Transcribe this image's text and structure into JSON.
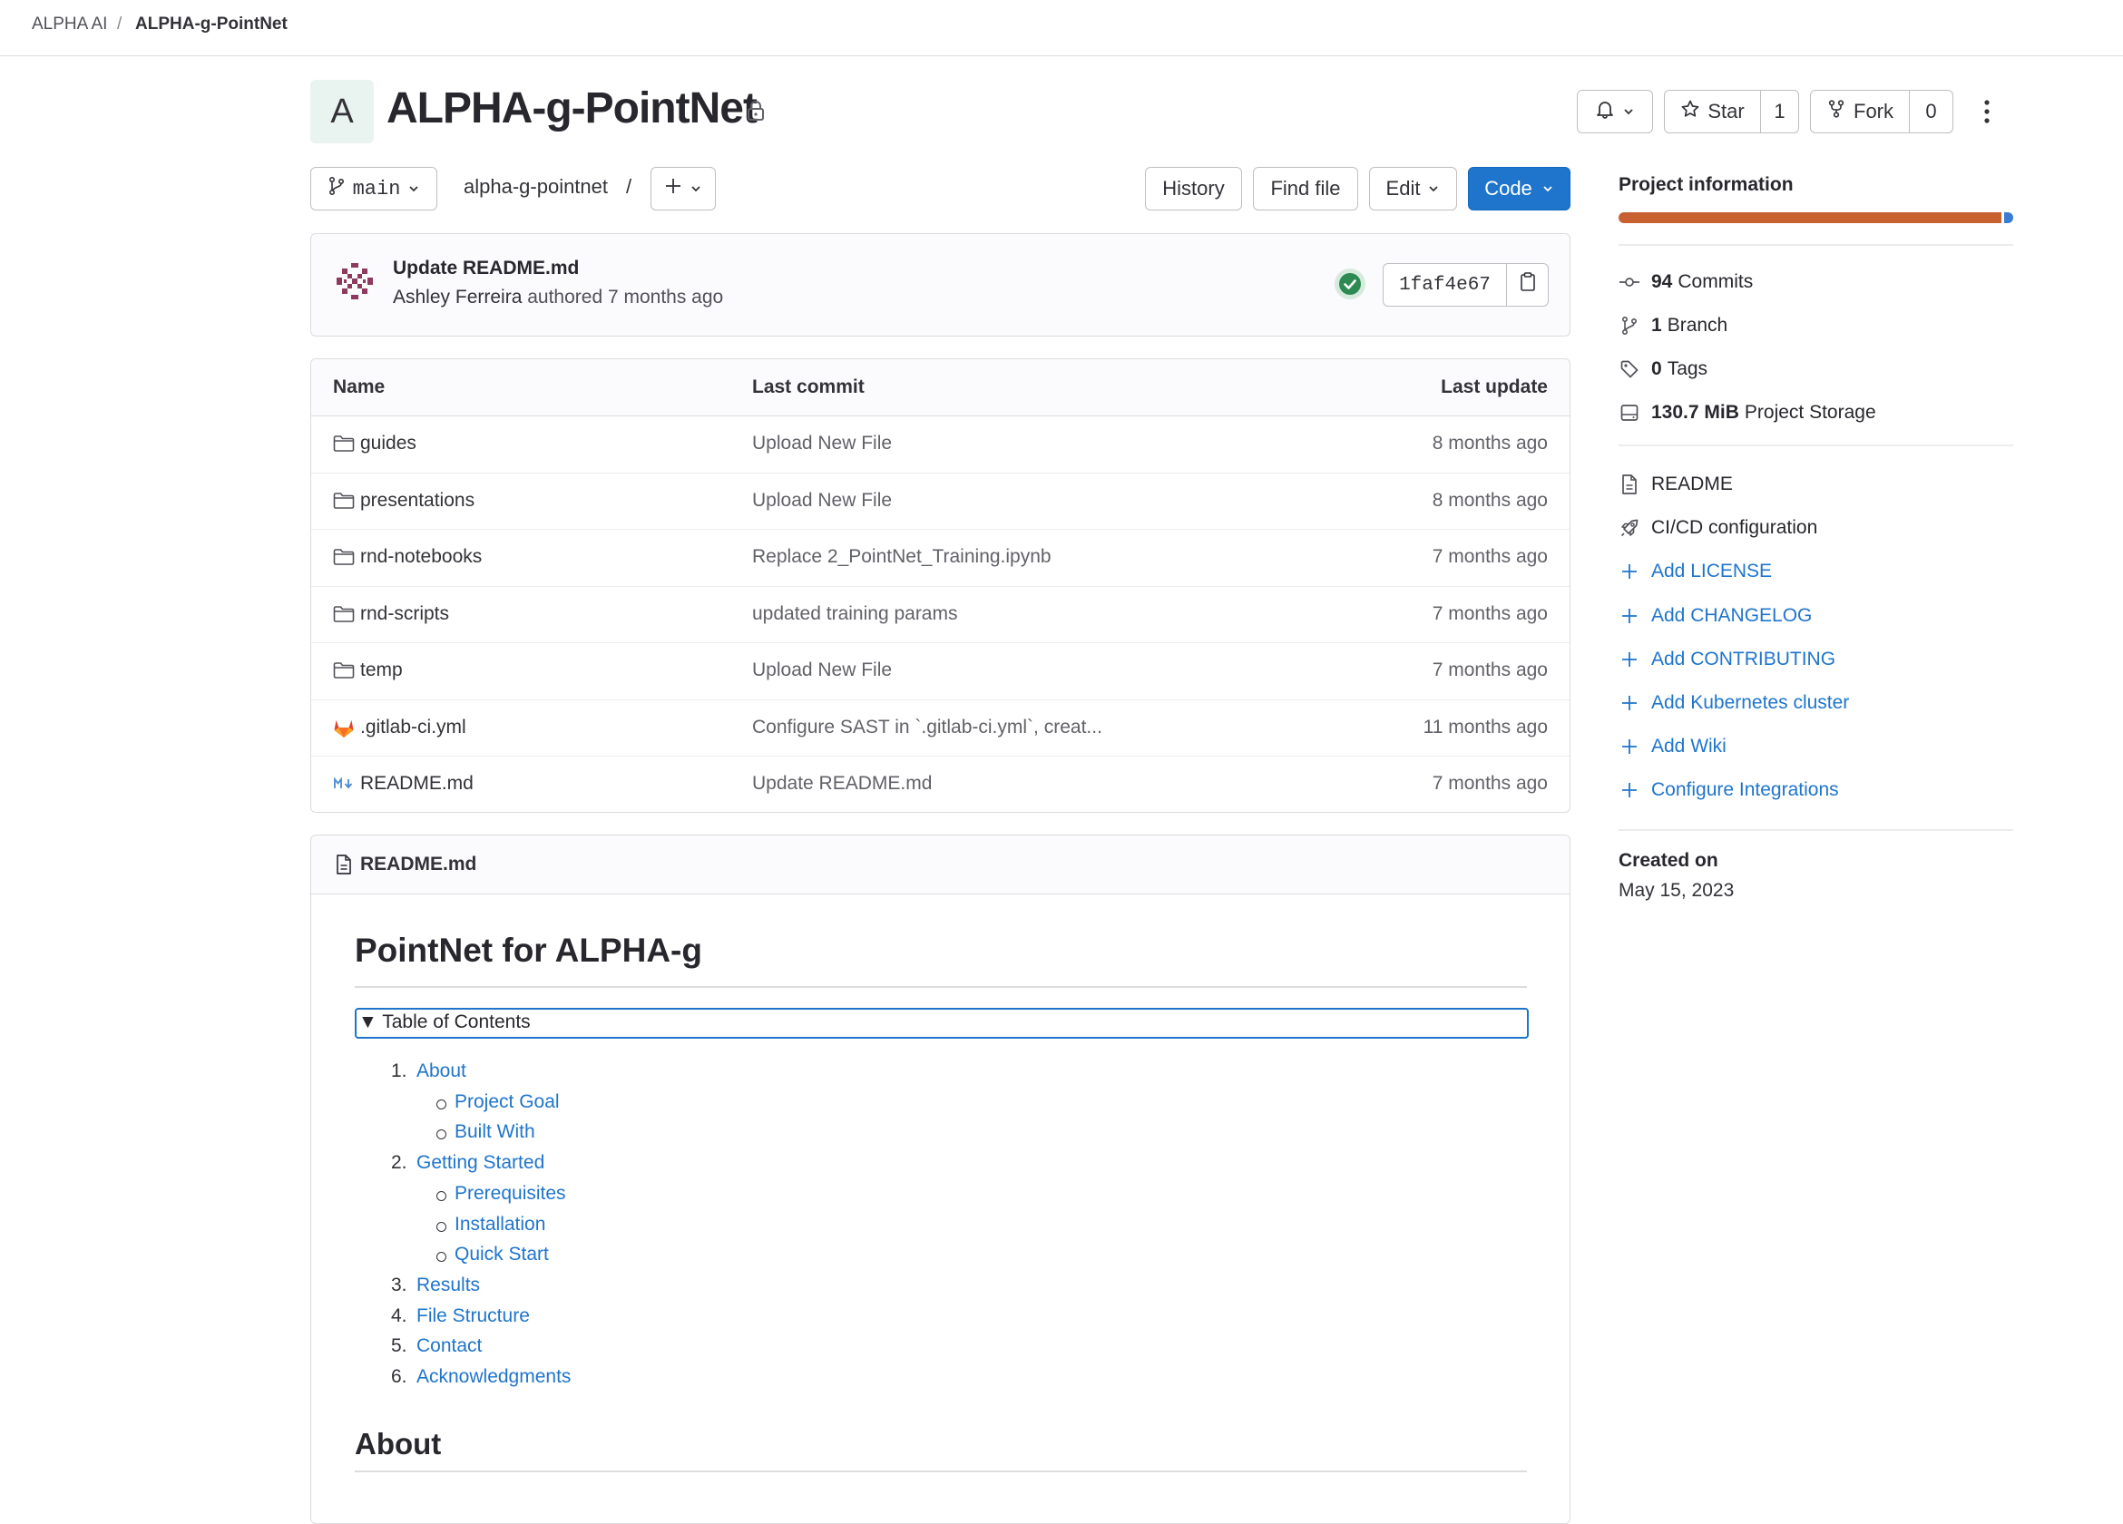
{
  "breadcrumb": {
    "group": "ALPHA AI",
    "separator": "/",
    "project": "ALPHA-g-PointNet"
  },
  "project": {
    "avatar_letter": "A",
    "title": "ALPHA-g-PointNet",
    "visibility_icon": "lock-icon"
  },
  "header_actions": {
    "notification_icon": "bell-icon",
    "star_label": "Star",
    "star_count": "1",
    "fork_label": "Fork",
    "fork_count": "0",
    "more_icon": "kebab-icon"
  },
  "toolbar": {
    "branch": "main",
    "path": "alpha-g-pointnet",
    "path_separator": "/",
    "history": "History",
    "find_file": "Find file",
    "edit": "Edit",
    "code": "Code"
  },
  "last_commit": {
    "title": "Update README.md",
    "author": "Ashley Ferreira",
    "meta": "authored 7 months ago",
    "status": "success",
    "sha": "1faf4e67"
  },
  "file_table": {
    "headers": {
      "name": "Name",
      "commit": "Last commit",
      "update": "Last update"
    },
    "rows": [
      {
        "icon": "folder-icon",
        "name": "guides",
        "commit": "Upload New File",
        "update": "8 months ago"
      },
      {
        "icon": "folder-icon",
        "name": "presentations",
        "commit": "Upload New File",
        "update": "8 months ago"
      },
      {
        "icon": "folder-icon",
        "name": "rnd-notebooks",
        "commit": "Replace 2_PointNet_Training.ipynb",
        "update": "7 months ago"
      },
      {
        "icon": "folder-icon",
        "name": "rnd-scripts",
        "commit": "updated training params",
        "update": "7 months ago"
      },
      {
        "icon": "folder-icon",
        "name": "temp",
        "commit": "Upload New File",
        "update": "7 months ago"
      },
      {
        "icon": "gitlab-icon",
        "name": ".gitlab-ci.yml",
        "commit": "Configure SAST in `.gitlab-ci.yml`, creat...",
        "update": "11 months ago"
      },
      {
        "icon": "markdown-icon",
        "name": "README.md",
        "commit": "Update README.md",
        "update": "7 months ago"
      }
    ]
  },
  "readme": {
    "filename": "README.md",
    "heading": "PointNet for ALPHA-g",
    "toc_summary": "▼ Table of Contents",
    "toc": [
      {
        "num": "1.",
        "label": "About",
        "children": [
          "Project Goal",
          "Built With"
        ]
      },
      {
        "num": "2.",
        "label": "Getting Started",
        "children": [
          "Prerequisites",
          "Installation",
          "Quick Start"
        ]
      },
      {
        "num": "3.",
        "label": "Results",
        "children": []
      },
      {
        "num": "4.",
        "label": "File Structure",
        "children": []
      },
      {
        "num": "5.",
        "label": "Contact",
        "children": []
      },
      {
        "num": "6.",
        "label": "Acknowledgments",
        "children": []
      }
    ],
    "section_heading": "About"
  },
  "sidebar": {
    "title": "Project information",
    "language_bar_colors": [
      "#c9602f",
      "#3a7bd5"
    ],
    "stats": [
      {
        "icon": "commit-icon",
        "value": "94",
        "label": "Commits"
      },
      {
        "icon": "branch-icon",
        "value": "1",
        "label": "Branch"
      },
      {
        "icon": "tag-icon",
        "value": "0",
        "label": "Tags"
      },
      {
        "icon": "storage-icon",
        "value": "130.7 MiB",
        "label": "Project Storage"
      }
    ],
    "links": [
      {
        "icon": "document-icon",
        "label": "README",
        "style": "plain"
      },
      {
        "icon": "rocket-icon",
        "label": "CI/CD configuration",
        "style": "plain"
      },
      {
        "icon": "plus-icon",
        "label": "Add LICENSE",
        "style": "link"
      },
      {
        "icon": "plus-icon",
        "label": "Add CHANGELOG",
        "style": "link"
      },
      {
        "icon": "plus-icon",
        "label": "Add CONTRIBUTING",
        "style": "link"
      },
      {
        "icon": "plus-icon",
        "label": "Add Kubernetes cluster",
        "style": "link"
      },
      {
        "icon": "plus-icon",
        "label": "Add Wiki",
        "style": "link"
      },
      {
        "icon": "plus-icon",
        "label": "Configure Integrations",
        "style": "link"
      }
    ],
    "created_label": "Created on",
    "created_value": "May 15, 2023"
  }
}
